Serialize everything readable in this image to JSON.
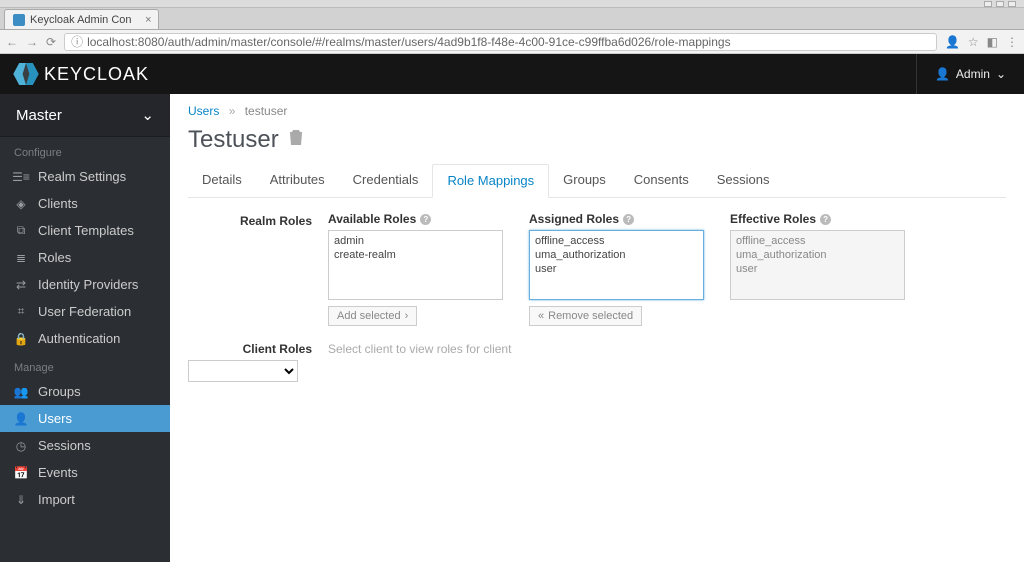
{
  "window": {
    "tab_title": "Keycloak Admin Con"
  },
  "address_bar": {
    "url": "localhost:8080/auth/admin/master/console/#/realms/master/users/4ad9b1f8-f48e-4c00-91ce-c99ffba6d026/role-mappings"
  },
  "header": {
    "brand": "KEYCLOAK",
    "user_label": "Admin"
  },
  "sidebar": {
    "realm": "Master",
    "configure_head": "Configure",
    "manage_head": "Manage",
    "configure": [
      {
        "label": "Realm Settings",
        "icon": "☰≡"
      },
      {
        "label": "Clients",
        "icon": "◈"
      },
      {
        "label": "Client Templates",
        "icon": "⧉"
      },
      {
        "label": "Roles",
        "icon": "≣"
      },
      {
        "label": "Identity Providers",
        "icon": "⇄"
      },
      {
        "label": "User Federation",
        "icon": "⌗"
      },
      {
        "label": "Authentication",
        "icon": "🔒"
      }
    ],
    "manage": [
      {
        "label": "Groups",
        "icon": "👥"
      },
      {
        "label": "Users",
        "icon": "👤",
        "active": true
      },
      {
        "label": "Sessions",
        "icon": "◷"
      },
      {
        "label": "Events",
        "icon": "📅"
      },
      {
        "label": "Import",
        "icon": "⇓"
      }
    ]
  },
  "breadcrumb": {
    "parent": "Users",
    "current": "testuser"
  },
  "page": {
    "title": "Testuser"
  },
  "tabs": [
    "Details",
    "Attributes",
    "Credentials",
    "Role Mappings",
    "Groups",
    "Consents",
    "Sessions"
  ],
  "active_tab": "Role Mappings",
  "roles": {
    "row_label": "Realm Roles",
    "available_head": "Available Roles",
    "assigned_head": "Assigned Roles",
    "effective_head": "Effective Roles",
    "available": [
      "admin",
      "create-realm"
    ],
    "assigned": [
      "offline_access",
      "uma_authorization",
      "user"
    ],
    "effective": [
      "offline_access",
      "uma_authorization",
      "user"
    ],
    "add_btn": "Add selected",
    "remove_btn": "Remove selected"
  },
  "client_roles": {
    "row_label": "Client Roles",
    "hint": "Select client to view roles for client"
  }
}
